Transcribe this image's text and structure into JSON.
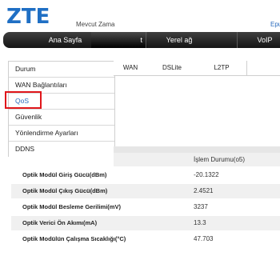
{
  "header": {
    "logo": "ZTE",
    "clock_label": "Mevcut Zama",
    "top_link": "Epu"
  },
  "nav": {
    "items": [
      {
        "label": "Ana Sayfa"
      },
      {
        "label": "t"
      },
      {
        "label": "Yerel ağ"
      },
      {
        "label": "VoIP"
      }
    ],
    "active_index": 1
  },
  "sidebar": {
    "items": [
      {
        "label": "Durum"
      },
      {
        "label": "WAN Bağlantıları"
      },
      {
        "label": "QoS"
      },
      {
        "label": "Güvenlik"
      },
      {
        "label": "Yönlendirme Ayarları"
      },
      {
        "label": "DDNS"
      }
    ],
    "highlighted": "QoS"
  },
  "tabs": [
    {
      "label": "WAN"
    },
    {
      "label": "DSLite"
    },
    {
      "label": "L2TP"
    }
  ],
  "optical_table": {
    "status_header": "İşlem Durumu(o5)",
    "rows": [
      {
        "param": "Optik Modül Giriş Gücü(dBm)",
        "value": "-20.1322"
      },
      {
        "param": "Optik Modül Çıkış Gücü(dBm)",
        "value": "2.4521"
      },
      {
        "param": "Optik Modül Besleme Gerilimi(mV)",
        "value": "3237"
      },
      {
        "param": "Optik Verici Ön Akımı(mA)",
        "value": "13.3"
      },
      {
        "param": "Optik Modülün Çalışma Sıcaklığı(°C)",
        "value": "47.703"
      }
    ]
  },
  "colors": {
    "brand": "#1f6fc4",
    "nav_bg": "#1e1e1e",
    "highlight_box": "#e0161b",
    "link": "#2a6bbd"
  }
}
